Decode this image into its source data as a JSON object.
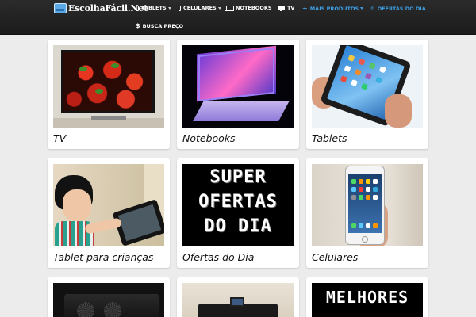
{
  "header": {
    "brand": "EscolhaFácil.Net",
    "nav": [
      {
        "label": "TABLETS",
        "icon": "tablet-icon",
        "dropdown": true
      },
      {
        "label": "CELULARES",
        "icon": "phone-icon",
        "dropdown": true
      },
      {
        "label": "NOTEBOOKS",
        "icon": "laptop-icon",
        "dropdown": false
      },
      {
        "label": "TV",
        "icon": "tv-icon",
        "dropdown": false
      },
      {
        "label": "MAIS PRODUTOS",
        "icon": "plus-icon",
        "dropdown": true
      },
      {
        "label": "OFERTAS DO DIA",
        "icon": "thumbs-up-icon",
        "dropdown": false
      },
      {
        "label": "BUSCA PREÇO",
        "icon": "dollar-icon",
        "dropdown": false
      }
    ]
  },
  "categories": [
    {
      "title": "TV"
    },
    {
      "title": "Notebooks"
    },
    {
      "title": "Tablets"
    },
    {
      "title": "Tablet para crianças"
    },
    {
      "title": "Ofertas do Dia"
    },
    {
      "title": "Celulares"
    }
  ],
  "images": {
    "ofertas_text": [
      "SUPER",
      "OFERTAS",
      "DO DIA"
    ],
    "melhores_text": "MELHORES"
  },
  "colors": {
    "navbar": "#1f1f1f",
    "accent": "#3e9fe6",
    "background": "#ececec"
  }
}
